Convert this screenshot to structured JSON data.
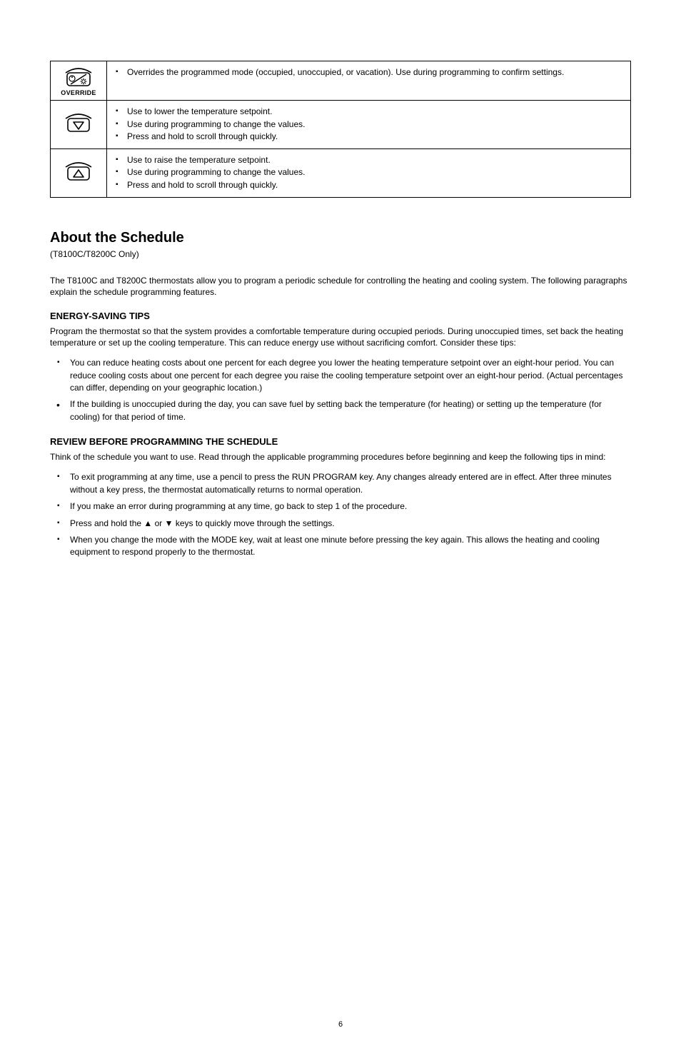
{
  "table": {
    "rows": [
      {
        "icon": "override",
        "items": [
          "Overrides the programmed mode (occupied, unoccupied, or vacation). Use during programming to confirm settings."
        ]
      },
      {
        "icon": "down",
        "items": [
          "Use to lower the temperature setpoint.",
          "Use during programming to change the values.",
          "Press and hold to scroll through quickly."
        ]
      },
      {
        "icon": "up",
        "items": [
          "Use to raise the temperature setpoint.",
          "Use during programming to change the values.",
          "Press and hold to scroll through quickly."
        ]
      }
    ]
  },
  "override_label": "OVERRIDE",
  "section_title": "About the Schedule",
  "section_sub": "(T8100C/T8200C Only)",
  "paras": {
    "intro": "The T8100C and T8200C thermostats allow you to program a periodic schedule for controlling the heating and cooling system. The following paragraphs explain the schedule programming features.",
    "energy_intro": "Program the thermostat so that the system provides a comfortable temperature during occupied periods. During unoccupied times, set back the heating temperature or set up the cooling temperature. This can reduce energy use without sacrificing comfort. Consider these tips:",
    "review_text": "Think of the schedule you want to use. Read through the applicable programming procedures before beginning and keep the following tips in mind:"
  },
  "energy_heading": "ENERGY-SAVING TIPS",
  "energy_tips": [
    "You can reduce heating costs about one percent for each degree you lower the heating temperature setpoint over an eight-hour period. You can reduce cooling costs about one percent for each degree you raise the cooling temperature setpoint over an eight-hour period. (Actual percentages can differ, depending on your geographic location.)",
    "If the building is unoccupied during the day, you can save fuel by setting back the temperature (for heating) or setting up the temperature (for cooling) for that period of time."
  ],
  "review_heading": "REVIEW BEFORE PROGRAMMING THE SCHEDULE",
  "review_tips": [
    "To exit programming at any time, use a pencil to press the RUN PROGRAM key. Any changes already entered are in effect. After three minutes without a key press, the thermostat automatically returns to normal operation.",
    "If you make an error during programming at any time, go back to step 1 of the procedure.",
    "Press and hold the  ▲  or  ▼  keys to quickly move through the settings.",
    "When you change the mode with the MODE key, wait at least one minute before pressing the key again. This allows the heating and cooling equipment to respond properly to the thermostat."
  ],
  "footer": "6"
}
